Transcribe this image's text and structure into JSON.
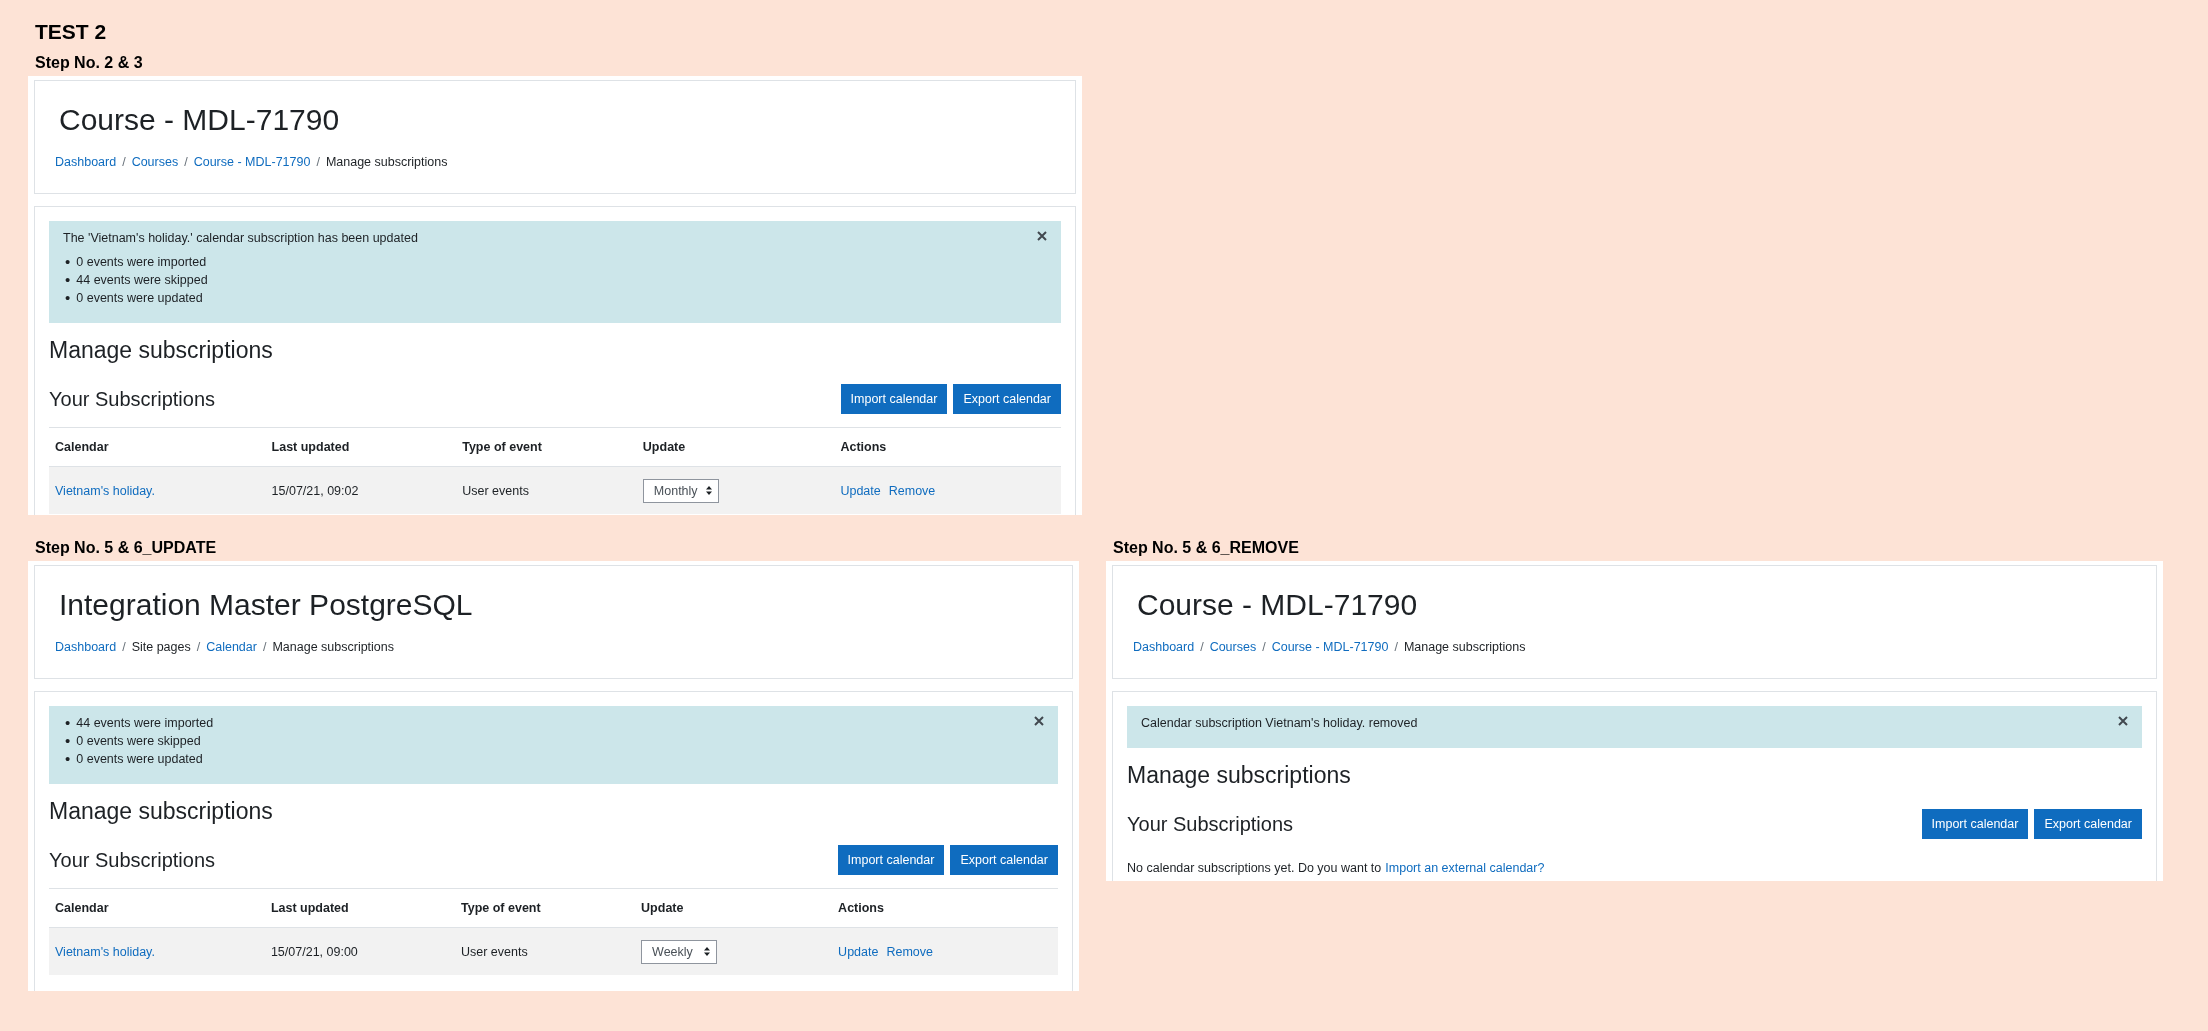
{
  "document": {
    "title": "TEST 2"
  },
  "steps": [
    {
      "label": "Step No. 2 & 3",
      "screenshot": {
        "page_title": "Course - MDL-71790",
        "breadcrumbs": [
          {
            "text": "Dashboard",
            "link": true
          },
          {
            "separator": "/",
            "text": "Courses",
            "link": true
          },
          {
            "separator": "/",
            "text": "Course - MDL-71790",
            "link": true
          },
          {
            "separator": "/",
            "text": "Manage subscriptions",
            "link": false
          }
        ],
        "alert": {
          "message": "The 'Vietnam's holiday.' calendar subscription has been updated",
          "items": [
            {
              "bullet": "•",
              "text": "0 events were imported"
            },
            {
              "bullet": "•",
              "text": "44 events were skipped"
            },
            {
              "bullet": "•",
              "text": "0 events were updated"
            }
          ]
        },
        "heading": "Manage subscriptions",
        "subheading": "Your Subscriptions",
        "buttons": [
          "Import calendar",
          "Export calendar"
        ],
        "table": {
          "columns": [
            "Calendar",
            "Last updated",
            "Type of event",
            "Update",
            "Actions"
          ],
          "rows": [
            {
              "calendar": "Vietnam's holiday.",
              "last_updated": "15/07/21, 09:02",
              "type": "User events",
              "update": "Monthly",
              "actions": [
                "Update",
                "Remove"
              ]
            }
          ]
        }
      }
    },
    {
      "label": "Step No. 5 & 6_UPDATE",
      "screenshot": {
        "page_title": "Integration Master PostgreSQL",
        "breadcrumbs": [
          {
            "text": "Dashboard",
            "link": true
          },
          {
            "separator": "/",
            "text": "Site pages",
            "link": false
          },
          {
            "separator": "/",
            "text": "Calendar",
            "link": true
          },
          {
            "separator": "/",
            "text": "Manage subscriptions",
            "link": false
          }
        ],
        "alert": {
          "items": [
            {
              "bullet": "•",
              "text": "44 events were imported"
            },
            {
              "bullet": "•",
              "text": "0 events were skipped"
            },
            {
              "bullet": "•",
              "text": "0 events were updated"
            }
          ]
        },
        "heading": "Manage subscriptions",
        "subheading": "Your Subscriptions",
        "buttons": [
          "Import calendar",
          "Export calendar"
        ],
        "table": {
          "columns": [
            "Calendar",
            "Last updated",
            "Type of event",
            "Update",
            "Actions"
          ],
          "rows": [
            {
              "calendar": "Vietnam's holiday.",
              "last_updated": "15/07/21, 09:00",
              "type": "User events",
              "update": "Weekly",
              "actions": [
                "Update",
                "Remove"
              ]
            }
          ]
        }
      }
    },
    {
      "label": "Step No. 5 & 6_REMOVE",
      "screenshot": {
        "page_title": "Course - MDL-71790",
        "breadcrumbs": [
          {
            "text": "Dashboard",
            "link": true
          },
          {
            "separator": "/",
            "text": "Courses",
            "link": true
          },
          {
            "separator": "/",
            "text": "Course - MDL-71790",
            "link": true
          },
          {
            "separator": "/",
            "text": "Manage subscriptions",
            "link": false
          }
        ],
        "alert": {
          "message": "Calendar subscription Vietnam's holiday. removed"
        },
        "heading": "Manage subscriptions",
        "subheading": "Your Subscriptions",
        "buttons": [
          "Import calendar",
          "Export calendar"
        ],
        "empty_message": {
          "text": "No calendar subscriptions yet. Do you want to",
          "link": "Import an external calendar?"
        }
      }
    }
  ]
}
